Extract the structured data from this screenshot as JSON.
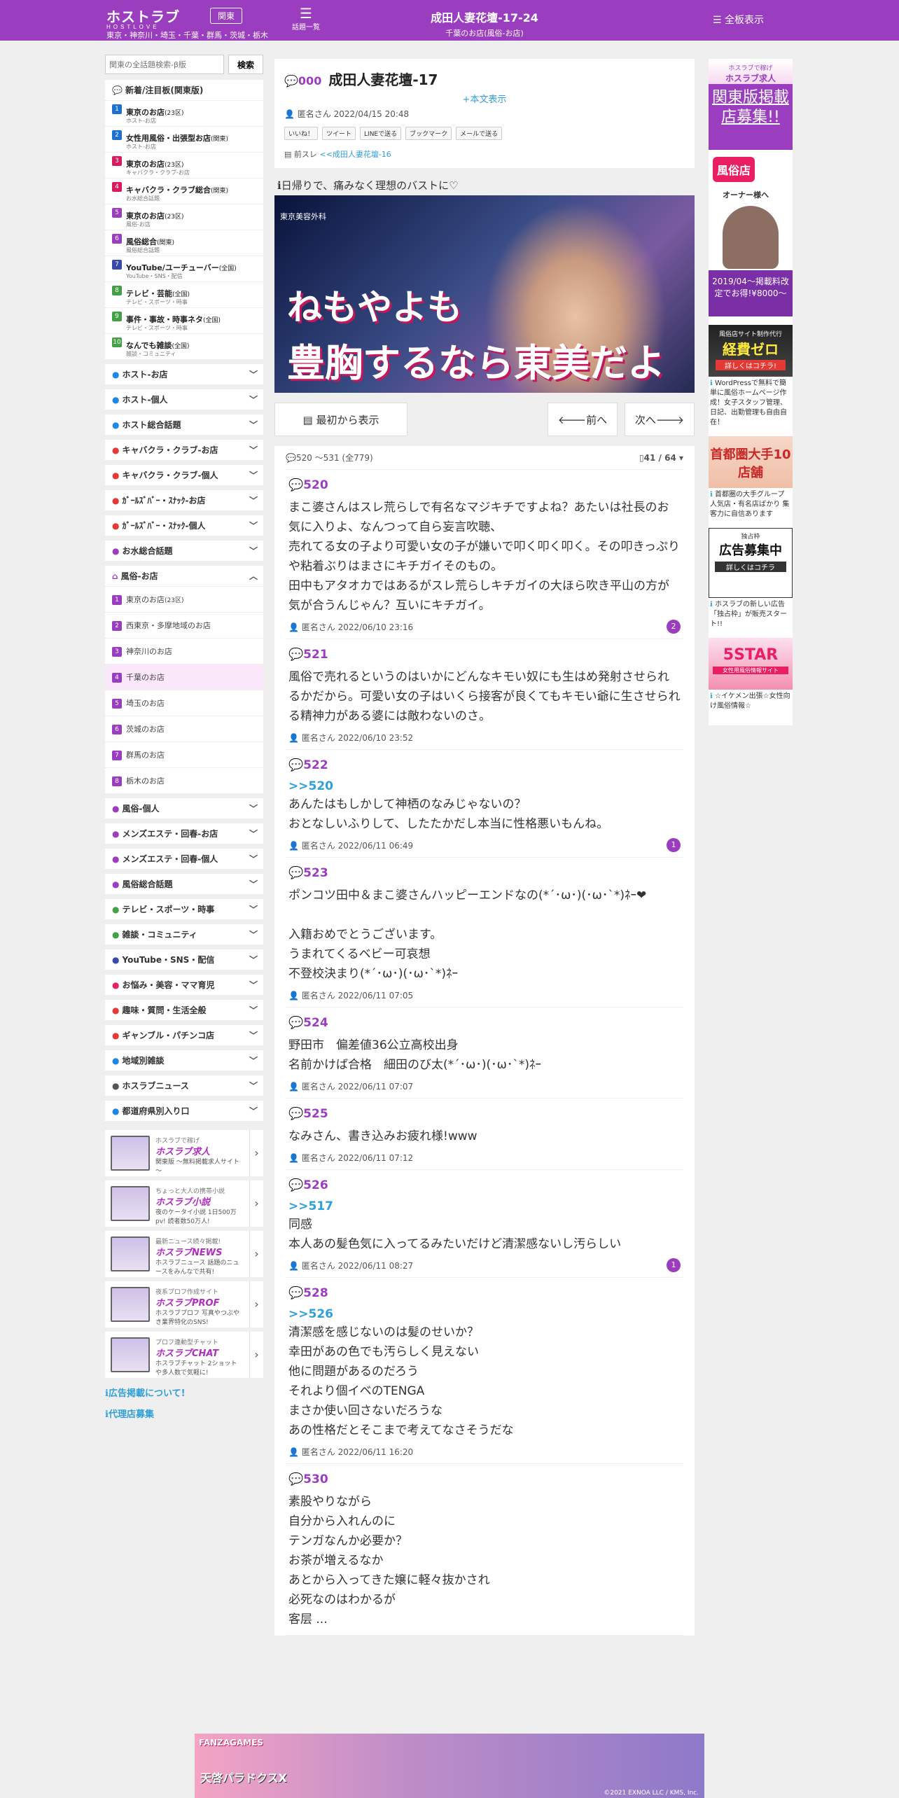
{
  "header": {
    "logo": "ホストラブ",
    "logo_sub": "HOSTLOVE",
    "area_button": "関東",
    "area_list": "東京・神奈川・埼玉・千葉・群馬・茨城・栃木",
    "topics_label": "話題一覧",
    "title": "成田人妻花壇-17-24",
    "subtitle": "千葉のお店(風俗-お店)",
    "all_boards": "全板表示"
  },
  "search": {
    "placeholder": "関東の全話題検索-β版",
    "button": "検索"
  },
  "sidebar": {
    "new_heading": "新着/注目板(関東版)",
    "new_items": [
      {
        "n": "1",
        "label": "東京のお店",
        "note": "(23区)",
        "sub": "ホスト-お店",
        "color": "#1e6fd0"
      },
      {
        "n": "2",
        "label": "女性用風俗・出張型お店",
        "note": "(関東)",
        "sub": "ホスト-お店",
        "color": "#1e6fd0"
      },
      {
        "n": "3",
        "label": "東京のお店",
        "note": "(23区)",
        "sub": "キャバクラ・クラブ-お店",
        "color": "#d81b60"
      },
      {
        "n": "4",
        "label": "キャバクラ・クラブ総合",
        "note": "(関東)",
        "sub": "お水総合話題",
        "color": "#d81b60"
      },
      {
        "n": "5",
        "label": "東京のお店",
        "note": "(23区)",
        "sub": "風俗-お店",
        "color": "#9b3dbf"
      },
      {
        "n": "6",
        "label": "風俗総合",
        "note": "(関東)",
        "sub": "風俗総合話題",
        "color": "#9b3dbf"
      },
      {
        "n": "7",
        "label": "YouTube/ユーチューバー",
        "note": "(全国)",
        "sub": "YouTube・SNS・配信",
        "color": "#3949ab"
      },
      {
        "n": "8",
        "label": "テレビ・芸能",
        "note": "(全国)",
        "sub": "テレビ・スポーツ・時事",
        "color": "#43a047"
      },
      {
        "n": "9",
        "label": "事件・事故・時事ネタ",
        "note": "(全国)",
        "sub": "テレビ・スポーツ・時事",
        "color": "#43a047"
      },
      {
        "n": "10",
        "label": "なんでも雑談",
        "note": "(全国)",
        "sub": "雑談・コミュニティ",
        "color": "#43a047"
      }
    ],
    "cats_a": [
      "ホスト-お店",
      "ホスト-個人",
      "ホスト総合話題",
      "キャバクラ・クラブ-お店",
      "キャバクラ・クラブ-個人",
      "ｶﾞｰﾙｽﾞﾊﾞｰ・ｽﾅｯｸ-お店",
      "ｶﾞｰﾙｽﾞﾊﾞｰ・ｽﾅｯｸ-個人",
      "お水総合話題"
    ],
    "fuzoku_heading": "風俗-お店",
    "fuzoku_items": [
      {
        "n": "1",
        "label": "東京のお店",
        "note": "(23区)"
      },
      {
        "n": "2",
        "label": "西東京・多摩地域のお店",
        "note": ""
      },
      {
        "n": "3",
        "label": "神奈川のお店",
        "note": ""
      },
      {
        "n": "4",
        "label": "千葉のお店",
        "note": ""
      },
      {
        "n": "5",
        "label": "埼玉のお店",
        "note": ""
      },
      {
        "n": "6",
        "label": "茨城のお店",
        "note": ""
      },
      {
        "n": "7",
        "label": "群馬のお店",
        "note": ""
      },
      {
        "n": "8",
        "label": "栃木のお店",
        "note": ""
      }
    ],
    "cats_b": [
      "風俗-個人",
      "メンズエステ・回春-お店",
      "メンズエステ・回春-個人",
      "風俗総合話題",
      "テレビ・スポーツ・時事",
      "雑談・コミュニティ",
      "YouTube・SNS・配信",
      "お悩み・美容・ママ育児",
      "趣味・質問・生活全般",
      "ギャンブル・パチンコ店",
      "地域別雑談",
      "ホスラブニュース",
      "都道府県別入り口"
    ],
    "banners": [
      {
        "t1": "ホスラブで稼げ",
        "t2": "ホスラブ求人",
        "t3": "関東版 ～無料掲載求人サイト～"
      },
      {
        "t1": "ちょっと大人の携帯小説",
        "t2": "ホスラブ小説",
        "t3": "夜のケータイ小説 1日500万pv! 読者数50万人!"
      },
      {
        "t1": "最新ニュース続々掲載!",
        "t2": "ホスラブNEWS",
        "t3": "ホスラブニュース 話題のニュースをみんなで共有!"
      },
      {
        "t1": "夜系プロフ作成サイト",
        "t2": "ホスラブPROF",
        "t3": "ホスラブプロフ 写真やつぶやき業界特化のSNS!"
      },
      {
        "t1": "プロフ連動型チャット",
        "t2": "ホスラブCHAT",
        "t3": "ホスラブチャット 2ショットや多人数で気軽に!"
      }
    ],
    "links": [
      "広告掲載について!",
      "代理店募集"
    ]
  },
  "thread": {
    "no": "000",
    "title": "成田人妻花壇-17",
    "more": "+本文表示",
    "author": "匿名さん",
    "date": "2022/04/15 20:48",
    "share": [
      "いいね！",
      "ツイート",
      "LINEで送る",
      "ブックマーク",
      "メールで送る"
    ],
    "prev_label": "前スレ",
    "prev_link": "<<成田人妻花壇-16"
  },
  "ad": {
    "caption": "日帰りで、痛みなく理想のバストに♡",
    "clinic": "東京美容外科",
    "line1": "ねもやよも",
    "line2": "豊胸するなら東美だよ"
  },
  "nav": {
    "first": "最初から表示",
    "prev": "前へ",
    "next": "次へ"
  },
  "range": {
    "text": "520 ～531 (全779)",
    "page": "41 / 64"
  },
  "posts": [
    {
      "no": "520",
      "ref": "",
      "body": "まこ婆さんはスレ荒らしで有名なマジキチですよね？あたいは社長のお気に入りよ、なんつって自ら妄言吹聴、\n売れてる女の子より可愛い女の子が嫌いで叩く叩く叩く。その叩きっぷりや粘着ぶりはまさにキチガイそのもの。\n田中もアタオカではあるがスレ荒らしキチガイの大ほら吹き平山の方が気が合うんじゃん？互いにキチガイ。",
      "author": "匿名さん",
      "date": "2022/06/10 23:16",
      "count": "2"
    },
    {
      "no": "521",
      "ref": "",
      "body": "風俗で売れるというのはいかにどんなキモい奴にも生はめ発射させられるかだから。可愛い女の子はいくら接客が良くてもキモい爺に生させられる精神力がある婆には敵わないのさ。",
      "author": "匿名さん",
      "date": "2022/06/10 23:52",
      "count": ""
    },
    {
      "no": "522",
      "ref": ">>520",
      "body": "あんたはもしかして神栖のなみじゃないの？\nおとなしいふりして、したたかだし本当に性格悪いもんね。",
      "author": "匿名さん",
      "date": "2022/06/11 06:49",
      "count": "1"
    },
    {
      "no": "523",
      "ref": "",
      "body": "ポンコツ田中＆まこ婆さんハッピーエンドなの(*´･ω･)(･ω･`*)ﾈｰ❤\n\n入籍おめでとうございます。\nうまれてくるベビー可哀想\n不登校決まり(*´･ω･)(･ω･`*)ﾈｰ",
      "author": "匿名さん",
      "date": "2022/06/11 07:05",
      "count": ""
    },
    {
      "no": "524",
      "ref": "",
      "body": "野田市　偏差値36公立高校出身\n名前かけば合格　細田のび太(*´･ω･)(･ω･`*)ﾈｰ",
      "author": "匿名さん",
      "date": "2022/06/11 07:07",
      "count": ""
    },
    {
      "no": "525",
      "ref": "",
      "body": "なみさん、書き込みお疲れ様!www",
      "author": "匿名さん",
      "date": "2022/06/11 07:12",
      "count": ""
    },
    {
      "no": "526",
      "ref": ">>517",
      "body": "同感\n本人あの髪色気に入ってるみたいだけど清潔感ないし汚らしい",
      "author": "匿名さん",
      "date": "2022/06/11 08:27",
      "count": "1"
    },
    {
      "no": "528",
      "ref": ">>526",
      "body": "清潔感を感じないのは髪のせいか？\n幸田があの色でも汚らしく見えない\n他に問題があるのだろう\nそれより個イベのTENGA\nまさか使い回さないだろうな\nあの性格だとそこまで考えてなさそうだな",
      "author": "匿名さん",
      "date": "2022/06/11 16:20",
      "count": ""
    },
    {
      "no": "530",
      "ref": "",
      "body": "素股やりながら\n自分から入れんのに\nテンガなんか必要か？\nお茶が増えるなか\nあとから入ってきた嬢に軽々抜かされ\n必死なのはわかるが\n客层 ... ",
      "author": "",
      "date": "",
      "count": ""
    }
  ],
  "right": {
    "ad1": {
      "top": "ホスラブで稼げ",
      "brand": "ホスラブ求人",
      "lines": "関東版掲載店募集!!",
      "sub": "風俗店",
      "sub2": "オーナー様へ",
      "price": "2019/04～掲載料改定でお得!¥8000～"
    },
    "ad2": {
      "top": "風俗店サイト制作代行",
      "title": "経費ゼロ",
      "btn": "詳しくはコチラ!",
      "info": "WordPressで無料で簡単に風俗ホームページ作成！女子スタッフ管理、日記、出勤管理も自由自在！"
    },
    "ad3": {
      "title": "首都圏大手10店舗",
      "info": "首都圏の大手グループ 人気店・有名店ばかり 集客力に自信あります"
    },
    "ad4": {
      "top": "独占枠",
      "title": "広告募集中",
      "btn": "詳しくはコチラ",
      "info": "ホスラブの新しい広告「独占枠」が販売スタート!!"
    },
    "ad5": {
      "title": "5STAR",
      "sub": "女性用風俗情報サイト",
      "info": "☆イケメン出張☆女性向け風俗情報☆"
    }
  },
  "footer": {
    "brand": "FANZAGAMES",
    "game": "天啓パラドクスX",
    "copyright": "©2021 EXNOA LLC / KMS, Inc."
  }
}
